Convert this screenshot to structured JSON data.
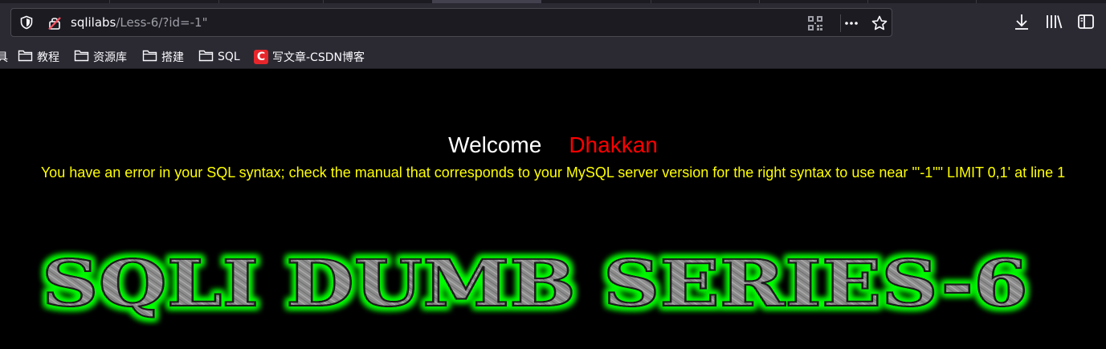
{
  "browser": {
    "url_host": "sqlilabs",
    "url_path": "/Less-6/?id=-1\"",
    "bookmarks": {
      "partial": "具",
      "items": [
        {
          "label": "教程",
          "icon": "folder-icon"
        },
        {
          "label": "资源库",
          "icon": "folder-icon"
        },
        {
          "label": "搭建",
          "icon": "folder-icon"
        },
        {
          "label": "SQL",
          "icon": "folder-icon"
        },
        {
          "label": "写文章-CSDN博客",
          "icon": "csdn-logo-icon"
        }
      ]
    },
    "csdn_logo_letter": "C"
  },
  "page": {
    "welcome": "Welcome",
    "username": "Dhakkan",
    "error": "You have an error in your SQL syntax; check the manual that corresponds to your MySQL server version for the right syntax to use near '\"-1\"\" LIMIT 0,1' at line 1",
    "banner": "SQLI DUMB SERIES-6"
  },
  "colors": {
    "background": "#000000",
    "welcome": "#ffffff",
    "username": "#ff0000",
    "error": "#ffff00",
    "banner_glow": "#00ff00",
    "banner_fill": "#8a8a8a",
    "csdn": "#e7262b"
  }
}
